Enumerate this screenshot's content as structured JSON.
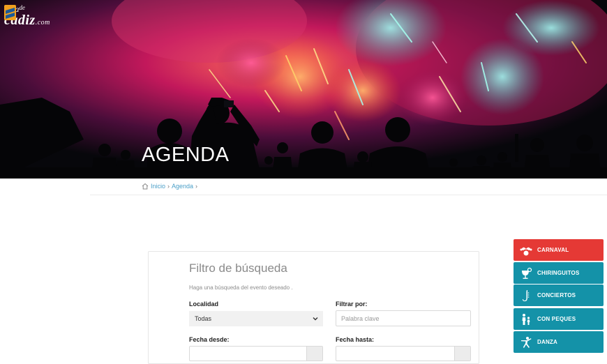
{
  "logo": {
    "line1": "guia",
    "line1_small": "de",
    "line2": "cadiz",
    "line2_small": ".com"
  },
  "hero": {
    "title": "AGENDA"
  },
  "breadcrumb": {
    "home": "Inicio",
    "sep1": "›",
    "current": "Agenda",
    "sep2": "›"
  },
  "filter": {
    "title": "Filtro de búsqueda",
    "subtitle": "Haga una búsqueda del evento deseado .",
    "localidad_label": "Localidad",
    "localidad_value": "Todas",
    "filtrar_label": "Filtrar por:",
    "filtrar_placeholder": "Palabra clave",
    "fecha_desde_label": "Fecha desde:",
    "fecha_hasta_label": "Fecha hasta:"
  },
  "categories": [
    {
      "label": "CARNAVAL",
      "icon": "jester-icon",
      "color": "#e53935"
    },
    {
      "label": "CHIRINGUITOS",
      "icon": "cocktail-icon",
      "color": "#1492a8"
    },
    {
      "label": "CONCIERTOS",
      "icon": "saxophone-icon",
      "color": "#1492a8"
    },
    {
      "label": "CON PEQUES",
      "icon": "family-icon",
      "color": "#1492a8"
    },
    {
      "label": "DANZA",
      "icon": "dancer-icon",
      "color": "#1492a8"
    }
  ]
}
